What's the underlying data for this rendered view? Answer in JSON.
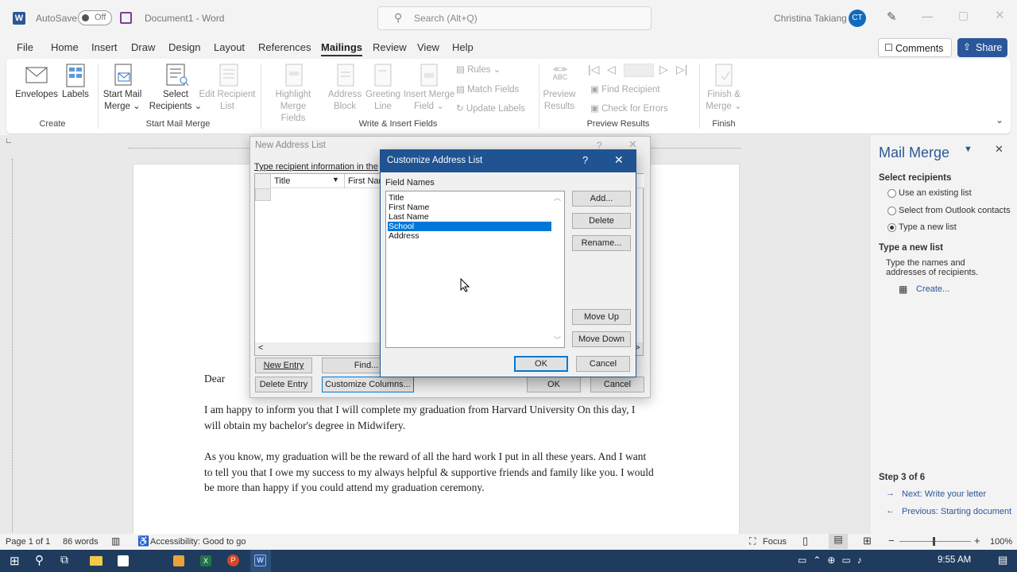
{
  "titlebar": {
    "autosave_label": "AutoSave",
    "autosave_state": "Off",
    "doc_title": "Document1 - Word",
    "search_placeholder": "Search (Alt+Q)",
    "user_name": "Christina Takiang",
    "user_initials": "CT"
  },
  "menu": {
    "items": [
      "File",
      "Home",
      "Insert",
      "Draw",
      "Design",
      "Layout",
      "References",
      "Mailings",
      "Review",
      "View",
      "Help"
    ],
    "comments_label": "Comments",
    "share_label": "Share"
  },
  "ribbon": {
    "create": {
      "group": "Create",
      "envelopes": "Envelopes",
      "labels": "Labels"
    },
    "start": {
      "group": "Start Mail Merge",
      "start_mail_merge": "Start Mail Merge",
      "select_recipients": "Select Recipients",
      "edit_recipient_list": "Edit Recipient List"
    },
    "write": {
      "group": "Write & Insert Fields",
      "highlight": "Highlight Merge Fields",
      "address_block": "Address Block",
      "greeting_line": "Greeting Line",
      "insert_merge_field": "Insert Merge Field",
      "rules": "Rules",
      "match_fields": "Match Fields",
      "update_labels": "Update Labels"
    },
    "preview": {
      "group": "Preview Results",
      "abc": "ABC",
      "preview_results": "Preview Results",
      "find_recipient": "Find Recipient",
      "check_errors": "Check for Errors"
    },
    "finish": {
      "group": "Finish",
      "finish_merge": "Finish & Merge"
    }
  },
  "document": {
    "dear": "Dear",
    "para1_line1": "I am happy to inform you that I will complete my graduation from Harvard University On this day, I",
    "para1_line2": "will obtain my bachelor's degree in Midwifery.",
    "para2_line1": "As you know, my graduation will be the reward of all the hard work I put in all these years. And I want",
    "para2_line2": "to tell you that I owe my success to my always helpful & supportive friends and family like you. I would",
    "para2_line3": "be more than happy if you could attend my graduation ceremony."
  },
  "new_address_list": {
    "title": "New Address List",
    "help": "?",
    "instruction": "Type recipient information in the",
    "col_title": "Title",
    "col_first_name": "First Nam",
    "new_entry": "New Entry",
    "find": "Find...",
    "delete_entry": "Delete Entry",
    "customize_columns": "Customize Columns...",
    "ok": "OK",
    "cancel": "Cancel"
  },
  "customize_dialog": {
    "title": "Customize Address List",
    "help": "?",
    "field_names_label": "Field Names",
    "fields": [
      "Title",
      "First Name",
      "Last Name",
      "School",
      "Address"
    ],
    "selected_index": 3,
    "add": "Add...",
    "delete": "Delete",
    "rename": "Rename...",
    "move_up": "Move Up",
    "move_down": "Move Down",
    "ok": "OK",
    "cancel": "Cancel"
  },
  "mail_merge_pane": {
    "title": "Mail Merge",
    "select_recipients": "Select recipients",
    "opt_existing": "Use an existing list",
    "opt_outlook": "Select from Outlook contacts",
    "opt_new": "Type a new list",
    "type_new_heading": "Type a new list",
    "type_new_desc_1": "Type the names and",
    "type_new_desc_2": "addresses of recipients.",
    "create_link": "Create...",
    "step": "Step 3 of 6",
    "next": "Next: Write your letter",
    "previous": "Previous: Starting document"
  },
  "status": {
    "page": "Page 1 of 1",
    "words": "86 words",
    "accessibility": "Accessibility: Good to go",
    "focus": "Focus",
    "zoom": "100%"
  },
  "taskbar": {
    "time": "9:55 AM"
  },
  "colors": {
    "accent": "#1f5391",
    "word_blue": "#2b579a",
    "selection": "#0078d7"
  }
}
